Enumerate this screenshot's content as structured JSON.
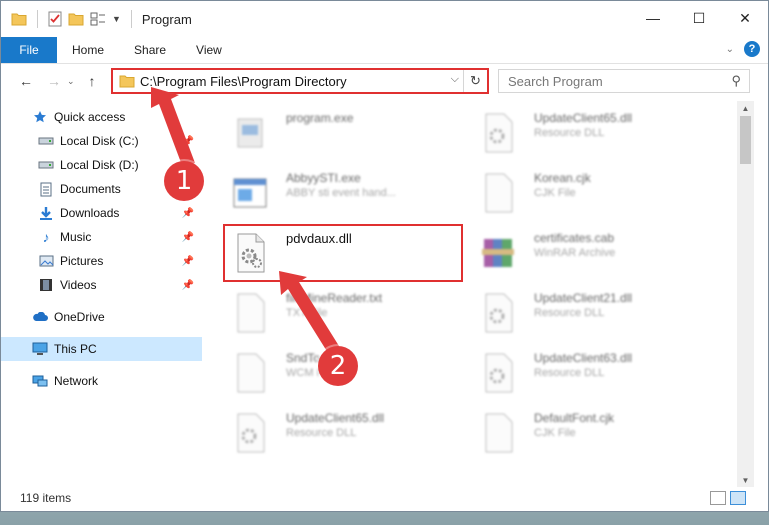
{
  "window": {
    "title": "Program",
    "controls": {
      "minimize": "—",
      "maximize": "☐",
      "close": "✕"
    }
  },
  "ribbon": {
    "file": "File",
    "tabs": [
      "Home",
      "Share",
      "View"
    ]
  },
  "address": {
    "path": "C:\\Program Files\\Program Directory",
    "search_placeholder": "Search Program"
  },
  "sidebar": {
    "items": [
      {
        "label": "Quick access",
        "icon": "star-icon",
        "pinned": false
      },
      {
        "label": "Local Disk (C:)",
        "icon": "drive-icon",
        "pinned": true
      },
      {
        "label": "Local Disk (D:)",
        "icon": "drive-icon",
        "pinned": true
      },
      {
        "label": "Documents",
        "icon": "documents-icon",
        "pinned": true
      },
      {
        "label": "Downloads",
        "icon": "download-icon",
        "pinned": true
      },
      {
        "label": "Music",
        "icon": "music-icon",
        "pinned": true
      },
      {
        "label": "Pictures",
        "icon": "pictures-icon",
        "pinned": true
      },
      {
        "label": "Videos",
        "icon": "videos-icon",
        "pinned": true
      },
      {
        "label": "OneDrive",
        "icon": "cloud-icon",
        "pinned": false
      },
      {
        "label": "This PC",
        "icon": "computer-icon",
        "pinned": false,
        "selected": true
      },
      {
        "label": "Network",
        "icon": "network-icon",
        "pinned": false
      }
    ]
  },
  "files": {
    "left": [
      {
        "name": "program.exe",
        "type": ""
      },
      {
        "name": "AbbyySTI.exe",
        "type": "ABBY sti event hand..."
      },
      {
        "name": "pdvdaux.dll",
        "type": ""
      },
      {
        "name": "fileMineReader.txt",
        "type": "TXT File"
      },
      {
        "name": "SndTo...",
        "type": "WCM File"
      },
      {
        "name": "UpdateClient65.dll",
        "type": "Resource DLL"
      }
    ],
    "right": [
      {
        "name": "UpdateClient65.dll",
        "type": "Resource DLL"
      },
      {
        "name": "Korean.cjk",
        "type": "CJK File"
      },
      {
        "name": "certificates.cab",
        "type": "WinRAR Archive"
      },
      {
        "name": "UpdateClient21.dll",
        "type": "Resource DLL"
      },
      {
        "name": "UpdateClient63.dll",
        "type": "Resource DLL"
      },
      {
        "name": "DefaultFont.cjk",
        "type": "CJK File"
      }
    ]
  },
  "annotations": {
    "step1": "1",
    "step2": "2"
  },
  "status": {
    "count": "119 items"
  },
  "colors": {
    "accent": "#1979ca",
    "highlight": "#e03030",
    "callout": "#e13b3b"
  }
}
